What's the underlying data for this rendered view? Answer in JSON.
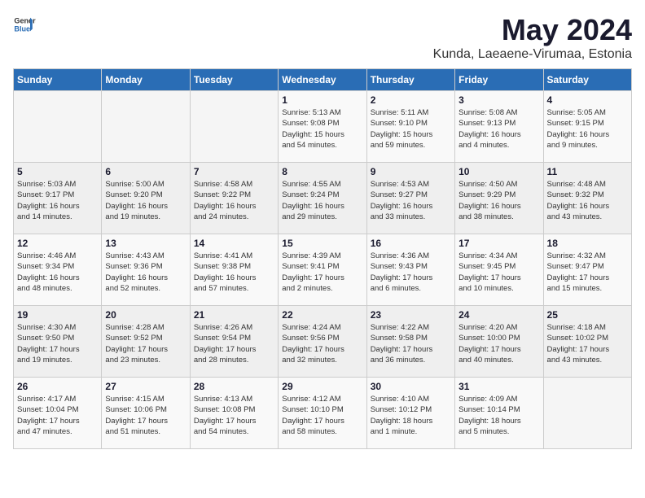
{
  "header": {
    "logo_general": "General",
    "logo_blue": "Blue",
    "title": "May 2024",
    "subtitle": "Kunda, Laeaene-Virumaa, Estonia"
  },
  "days_of_week": [
    "Sunday",
    "Monday",
    "Tuesday",
    "Wednesday",
    "Thursday",
    "Friday",
    "Saturday"
  ],
  "weeks": [
    [
      {
        "day": "",
        "info": ""
      },
      {
        "day": "",
        "info": ""
      },
      {
        "day": "",
        "info": ""
      },
      {
        "day": "1",
        "info": "Sunrise: 5:13 AM\nSunset: 9:08 PM\nDaylight: 15 hours\nand 54 minutes."
      },
      {
        "day": "2",
        "info": "Sunrise: 5:11 AM\nSunset: 9:10 PM\nDaylight: 15 hours\nand 59 minutes."
      },
      {
        "day": "3",
        "info": "Sunrise: 5:08 AM\nSunset: 9:13 PM\nDaylight: 16 hours\nand 4 minutes."
      },
      {
        "day": "4",
        "info": "Sunrise: 5:05 AM\nSunset: 9:15 PM\nDaylight: 16 hours\nand 9 minutes."
      }
    ],
    [
      {
        "day": "5",
        "info": "Sunrise: 5:03 AM\nSunset: 9:17 PM\nDaylight: 16 hours\nand 14 minutes."
      },
      {
        "day": "6",
        "info": "Sunrise: 5:00 AM\nSunset: 9:20 PM\nDaylight: 16 hours\nand 19 minutes."
      },
      {
        "day": "7",
        "info": "Sunrise: 4:58 AM\nSunset: 9:22 PM\nDaylight: 16 hours\nand 24 minutes."
      },
      {
        "day": "8",
        "info": "Sunrise: 4:55 AM\nSunset: 9:24 PM\nDaylight: 16 hours\nand 29 minutes."
      },
      {
        "day": "9",
        "info": "Sunrise: 4:53 AM\nSunset: 9:27 PM\nDaylight: 16 hours\nand 33 minutes."
      },
      {
        "day": "10",
        "info": "Sunrise: 4:50 AM\nSunset: 9:29 PM\nDaylight: 16 hours\nand 38 minutes."
      },
      {
        "day": "11",
        "info": "Sunrise: 4:48 AM\nSunset: 9:32 PM\nDaylight: 16 hours\nand 43 minutes."
      }
    ],
    [
      {
        "day": "12",
        "info": "Sunrise: 4:46 AM\nSunset: 9:34 PM\nDaylight: 16 hours\nand 48 minutes."
      },
      {
        "day": "13",
        "info": "Sunrise: 4:43 AM\nSunset: 9:36 PM\nDaylight: 16 hours\nand 52 minutes."
      },
      {
        "day": "14",
        "info": "Sunrise: 4:41 AM\nSunset: 9:38 PM\nDaylight: 16 hours\nand 57 minutes."
      },
      {
        "day": "15",
        "info": "Sunrise: 4:39 AM\nSunset: 9:41 PM\nDaylight: 17 hours\nand 2 minutes."
      },
      {
        "day": "16",
        "info": "Sunrise: 4:36 AM\nSunset: 9:43 PM\nDaylight: 17 hours\nand 6 minutes."
      },
      {
        "day": "17",
        "info": "Sunrise: 4:34 AM\nSunset: 9:45 PM\nDaylight: 17 hours\nand 10 minutes."
      },
      {
        "day": "18",
        "info": "Sunrise: 4:32 AM\nSunset: 9:47 PM\nDaylight: 17 hours\nand 15 minutes."
      }
    ],
    [
      {
        "day": "19",
        "info": "Sunrise: 4:30 AM\nSunset: 9:50 PM\nDaylight: 17 hours\nand 19 minutes."
      },
      {
        "day": "20",
        "info": "Sunrise: 4:28 AM\nSunset: 9:52 PM\nDaylight: 17 hours\nand 23 minutes."
      },
      {
        "day": "21",
        "info": "Sunrise: 4:26 AM\nSunset: 9:54 PM\nDaylight: 17 hours\nand 28 minutes."
      },
      {
        "day": "22",
        "info": "Sunrise: 4:24 AM\nSunset: 9:56 PM\nDaylight: 17 hours\nand 32 minutes."
      },
      {
        "day": "23",
        "info": "Sunrise: 4:22 AM\nSunset: 9:58 PM\nDaylight: 17 hours\nand 36 minutes."
      },
      {
        "day": "24",
        "info": "Sunrise: 4:20 AM\nSunset: 10:00 PM\nDaylight: 17 hours\nand 40 minutes."
      },
      {
        "day": "25",
        "info": "Sunrise: 4:18 AM\nSunset: 10:02 PM\nDaylight: 17 hours\nand 43 minutes."
      }
    ],
    [
      {
        "day": "26",
        "info": "Sunrise: 4:17 AM\nSunset: 10:04 PM\nDaylight: 17 hours\nand 47 minutes."
      },
      {
        "day": "27",
        "info": "Sunrise: 4:15 AM\nSunset: 10:06 PM\nDaylight: 17 hours\nand 51 minutes."
      },
      {
        "day": "28",
        "info": "Sunrise: 4:13 AM\nSunset: 10:08 PM\nDaylight: 17 hours\nand 54 minutes."
      },
      {
        "day": "29",
        "info": "Sunrise: 4:12 AM\nSunset: 10:10 PM\nDaylight: 17 hours\nand 58 minutes."
      },
      {
        "day": "30",
        "info": "Sunrise: 4:10 AM\nSunset: 10:12 PM\nDaylight: 18 hours\nand 1 minute."
      },
      {
        "day": "31",
        "info": "Sunrise: 4:09 AM\nSunset: 10:14 PM\nDaylight: 18 hours\nand 5 minutes."
      },
      {
        "day": "",
        "info": ""
      }
    ]
  ]
}
